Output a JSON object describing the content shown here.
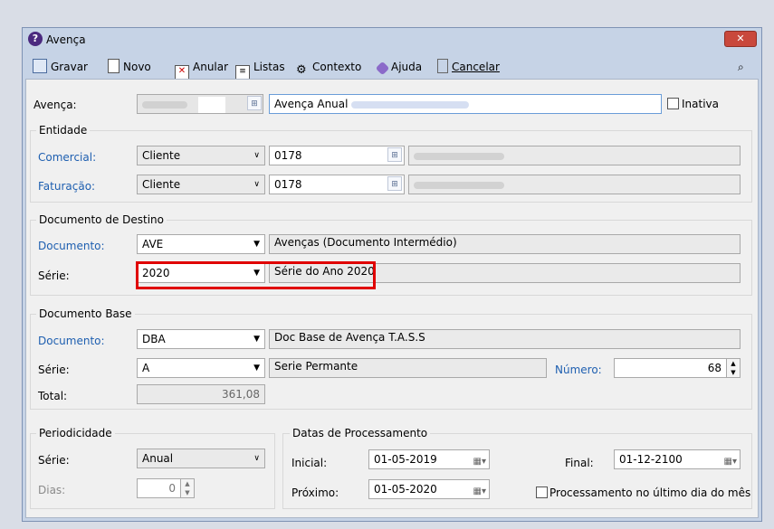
{
  "window": {
    "title": "Avença",
    "close_glyph": "✕"
  },
  "toolbar": {
    "save": "Gravar",
    "new": "Novo",
    "cancel_doc": "Anular",
    "lists": "Listas",
    "context": "Contexto",
    "help": "Ajuda",
    "cancel": "Cancelar"
  },
  "avenca": {
    "label": "Avença:",
    "description": "Avença Anual",
    "inactive_label": "Inativa"
  },
  "entidade": {
    "title": "Entidade",
    "comercial": {
      "label": "Comercial:",
      "type": "Cliente",
      "code": "0178"
    },
    "faturacao": {
      "label": "Faturação:",
      "type": "Cliente",
      "code": "0178"
    }
  },
  "destino": {
    "title": "Documento de Destino",
    "documento": {
      "label": "Documento:",
      "value": "AVE",
      "description": "Avenças (Documento Intermédio)"
    },
    "serie": {
      "label": "Série:",
      "value": "2020",
      "description": "Série do Ano 2020"
    },
    "highlight_color": "#e00000"
  },
  "base": {
    "title": "Documento Base",
    "documento": {
      "label": "Documento:",
      "value": "DBA",
      "description": "Doc Base de Avença T.A.S.S"
    },
    "serie": {
      "label": "Série:",
      "value": "A",
      "description": "Serie Permante"
    },
    "numero": {
      "label": "Número:",
      "value": "68"
    },
    "total": {
      "label": "Total:",
      "value": "361,08"
    }
  },
  "periodicidade": {
    "title": "Periodicidade",
    "serie": {
      "label": "Série:",
      "value": "Anual"
    },
    "dias": {
      "label": "Dias:",
      "value": "0"
    }
  },
  "datas": {
    "title": "Datas de Processamento",
    "inicial": {
      "label": "Inicial:",
      "value": "01-05-2019"
    },
    "proximo": {
      "label": "Próximo:",
      "value": "01-05-2020"
    },
    "final": {
      "label": "Final:",
      "value": "01-12-2100"
    },
    "last_day_label": "Processamento no último dia do mês"
  },
  "colors": {
    "accent": "#1e5fb0",
    "title_bar": "#c6d3e6"
  }
}
